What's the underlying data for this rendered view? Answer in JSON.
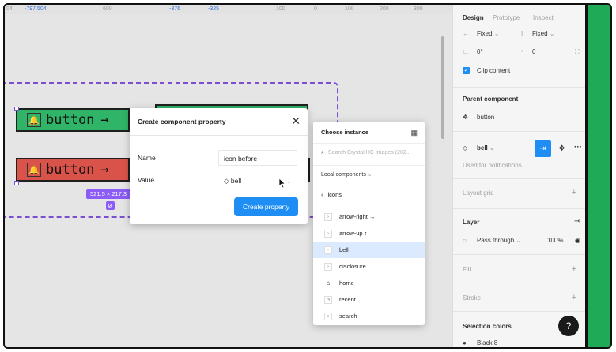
{
  "ruler": {
    "marks": [
      "04",
      "-797.504",
      "600",
      "-376",
      "-325",
      "100",
      "0",
      "100",
      "200",
      "300"
    ]
  },
  "canvas": {
    "button_label": "button",
    "arrow": "→",
    "dim_label": "521.5 × 217.3"
  },
  "modal": {
    "title": "Create component property",
    "name_label": "Name",
    "name_value": "icon before",
    "value_label": "Value",
    "value_selected": "bell",
    "create_button": "Create property"
  },
  "instance_picker": {
    "title": "Choose instance",
    "search_placeholder": "Search Crystal HC Images (202...",
    "library": "Local components",
    "back_label": "icons",
    "items": [
      {
        "label": "arrow-right →",
        "icon": "arrow-right-icon",
        "selected": false
      },
      {
        "label": "arrow-up ↑",
        "icon": "arrow-up-icon",
        "selected": false
      },
      {
        "label": "bell",
        "icon": "bell-icon",
        "selected": true
      },
      {
        "label": "disclosure",
        "icon": "disclosure-icon",
        "selected": false
      },
      {
        "label": "home",
        "icon": "home-icon",
        "selected": false
      },
      {
        "label": "recent",
        "icon": "recent-icon",
        "selected": false
      },
      {
        "label": "search",
        "icon": "search-icon",
        "selected": false
      }
    ]
  },
  "panel": {
    "tabs": [
      "Design",
      "Prototype",
      "Inspect"
    ],
    "width_mode": "Fixed",
    "height_mode": "Fixed",
    "rotation": "0°",
    "radius": "0",
    "clip_content": "Clip content",
    "parent_component_title": "Parent component",
    "parent_component_name": "button",
    "instance_name": "bell",
    "used_for": "Used for notifications",
    "layout_grid": "Layout grid",
    "layer_title": "Layer",
    "blend_mode": "Pass through",
    "opacity": "100%",
    "fill": "Fill",
    "stroke": "Stroke",
    "selection_colors": "Selection colors",
    "color_name": "Black 8",
    "help": "?"
  },
  "colors": {
    "accent": "#1e8ef5",
    "green_button": "#2fb468",
    "red_button": "#d9534a",
    "selection": "#7b4fd0",
    "right_bar": "#1faa58"
  }
}
